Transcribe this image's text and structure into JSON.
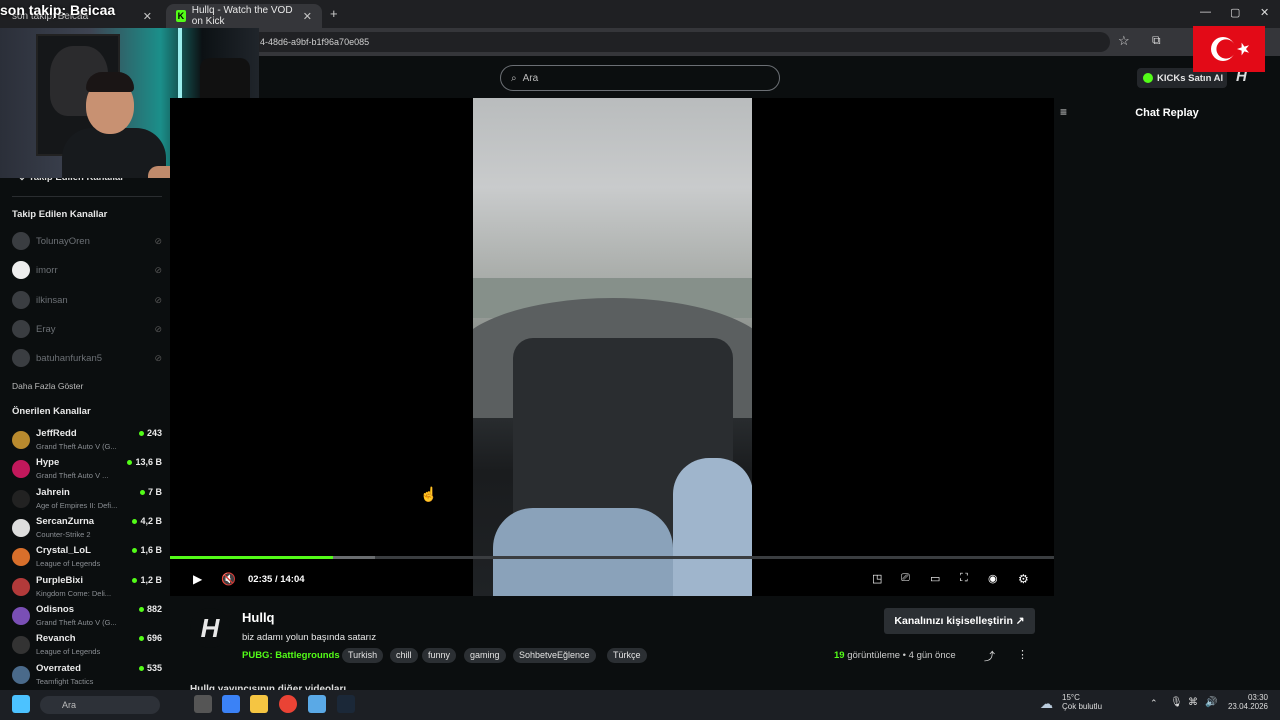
{
  "browser": {
    "tabs": [
      {
        "label": "son takip: Beicaa",
        "active": false
      },
      {
        "label": "Hullq - Watch the VOD on Kick",
        "active": true
      }
    ],
    "new_tab": "+",
    "url": "4-48d6-a9bf-b1f96a70e085",
    "window_controls": {
      "minimize": "—",
      "maximize": "▢",
      "close": "✕"
    }
  },
  "overlay": {
    "follow_text": "son takip: Beicaa",
    "flag": "Turkey"
  },
  "header": {
    "search_placeholder": "Ara",
    "kicks_button": "KICKs Satın Al",
    "logo": "H"
  },
  "sidebar": {
    "collapsed_section": "Takip Edilen Kanallar",
    "followed_heading": "Takip Edilen Kanallar",
    "followed": [
      {
        "name": "TolunayOren"
      },
      {
        "name": "imorr"
      },
      {
        "name": "ilkinsan"
      },
      {
        "name": "Eray"
      },
      {
        "name": "batuhanfurkan5"
      }
    ],
    "show_more": "Daha Fazla Göster",
    "recommended_heading": "Önerilen Kanallar",
    "recommended": [
      {
        "name": "JeffRedd",
        "game": "Grand Theft Auto V (G...",
        "viewers": "243",
        "color": "#b98a2e"
      },
      {
        "name": "Hype",
        "game": "Grand Theft Auto V ...",
        "viewers": "13,6 B",
        "color": "#c2185b"
      },
      {
        "name": "Jahrein",
        "game": "Age of Empires II: Defi...",
        "viewers": "7 B",
        "color": "#222"
      },
      {
        "name": "SercanZurna",
        "game": "Counter-Strike 2",
        "viewers": "4,2 B",
        "color": "#dddddd"
      },
      {
        "name": "Crystal_LoL",
        "game": "League of Legends",
        "viewers": "1,6 B",
        "color": "#d86f2b"
      },
      {
        "name": "PurpleBixi",
        "game": "Kingdom Come: Deli...",
        "viewers": "1,2 B",
        "color": "#b23a3a"
      },
      {
        "name": "Odisnos",
        "game": "Grand Theft Auto V (G...",
        "viewers": "882",
        "color": "#7a4fb5"
      },
      {
        "name": "Revanch",
        "game": "League of Legends",
        "viewers": "696",
        "color": "#333"
      },
      {
        "name": "Overrated",
        "game": "Teamfight Tactics",
        "viewers": "535",
        "color": "#4a6a8a"
      }
    ]
  },
  "player": {
    "current_time": "02:35",
    "separator": "/",
    "duration": "14:04",
    "progress_fraction": 0.184,
    "buffered_fraction": 0.232
  },
  "chat": {
    "title": "Chat Replay"
  },
  "channel": {
    "name": "Hullq",
    "logo": "H",
    "vod_title": "biz adamı yolun başında satarız",
    "category": "PUBG: Battlegrounds",
    "tags": [
      "Turkish",
      "chill",
      "funny",
      "gaming",
      "SohbetveEğlence",
      "Türkçe"
    ],
    "views_count": "19",
    "views_label": "görüntüleme",
    "bullet": "•",
    "age": "4 gün önce",
    "personalize_button": "Kanalınızı kişiselleştirin",
    "more_videos": "Hullq yayıncısının diğer videoları"
  },
  "taskbar": {
    "search_text": "Ara",
    "weather_temp": "15°C",
    "weather_desc": "Çok bulutlu",
    "time": "03:30",
    "date": "23.04.2026"
  },
  "colors": {
    "accent": "#53fc18",
    "background": "#0b0e0f",
    "tag_bg": "#2b2f33"
  }
}
